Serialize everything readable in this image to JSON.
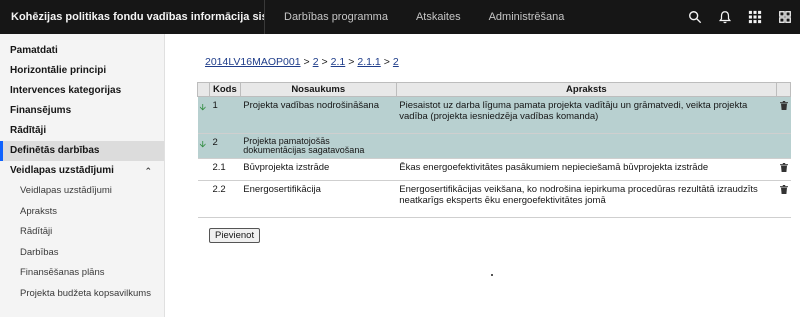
{
  "header": {
    "app_title": "Kohēzijas politikas fondu vadības informācija sistēma",
    "nav": [
      "Darbības programma",
      "Atskaites",
      "Administrēšana"
    ],
    "icons": [
      "search-icon",
      "bell-icon",
      "apps-grid-icon",
      "app-switcher-icon"
    ]
  },
  "sidebar": {
    "items": [
      {
        "label": "Pamatdati"
      },
      {
        "label": "Horizontālie principi"
      },
      {
        "label": "Intervences kategorijas"
      },
      {
        "label": "Finansējums"
      },
      {
        "label": "Rādītāji"
      },
      {
        "label": "Definētās darbības",
        "active": true
      },
      {
        "label": "Veidlapas uzstādījumi",
        "expanded": true
      }
    ],
    "sub_items": [
      "Veidlapas uzstādījumi",
      "Apraksts",
      "Rādītāji",
      "Darbības",
      "Finansēšanas plāns",
      "Projekta budžeta kopsavilkums"
    ]
  },
  "breadcrumb": [
    "2014LV16MAOP001",
    "2",
    "2.1",
    "2.1.1",
    "2"
  ],
  "table": {
    "headers": [
      "Kods",
      "Nosaukums",
      "Apraksts"
    ],
    "rows": [
      {
        "kods": "1",
        "nosaukums": "Projekta vadības nodrošināšana",
        "apraksts": "Piesaistot uz darba līguma pamata projekta vadītāju un grāmatvedi, veikta projekta vadība (projekta iesniedzēja vadības komanda)",
        "highlighted": true,
        "arrow": true,
        "delete": true
      },
      {
        "kods": "2",
        "nosaukums": "Projekta pamatojošās dokumentācijas sagatavošana",
        "apraksts": "",
        "highlighted": true,
        "arrow": true,
        "delete": false
      },
      {
        "kods": "2.1",
        "nosaukums": "Būvprojekta izstrāde",
        "apraksts": "Ēkas energoefektivitātes pasākumiem nepieciešamā būvprojekta izstrāde",
        "highlighted": false,
        "arrow": false,
        "delete": true
      },
      {
        "kods": "2.2",
        "nosaukums": "Energosertifikācija",
        "apraksts": "Energosertifikācijas veikšana, ko nodrošina iepirkuma procedūras rezultātā izraudzīts neatkarīgs eksperts ēku energoefektivitātes jomā",
        "highlighted": false,
        "arrow": false,
        "delete": true
      }
    ]
  },
  "add_button_label": "Pievienot",
  "colors": {
    "topbar": "#161616",
    "highlight_row": "#b8d0d0",
    "link": "#1f3d8a",
    "arrow": "#2e8b3d"
  }
}
